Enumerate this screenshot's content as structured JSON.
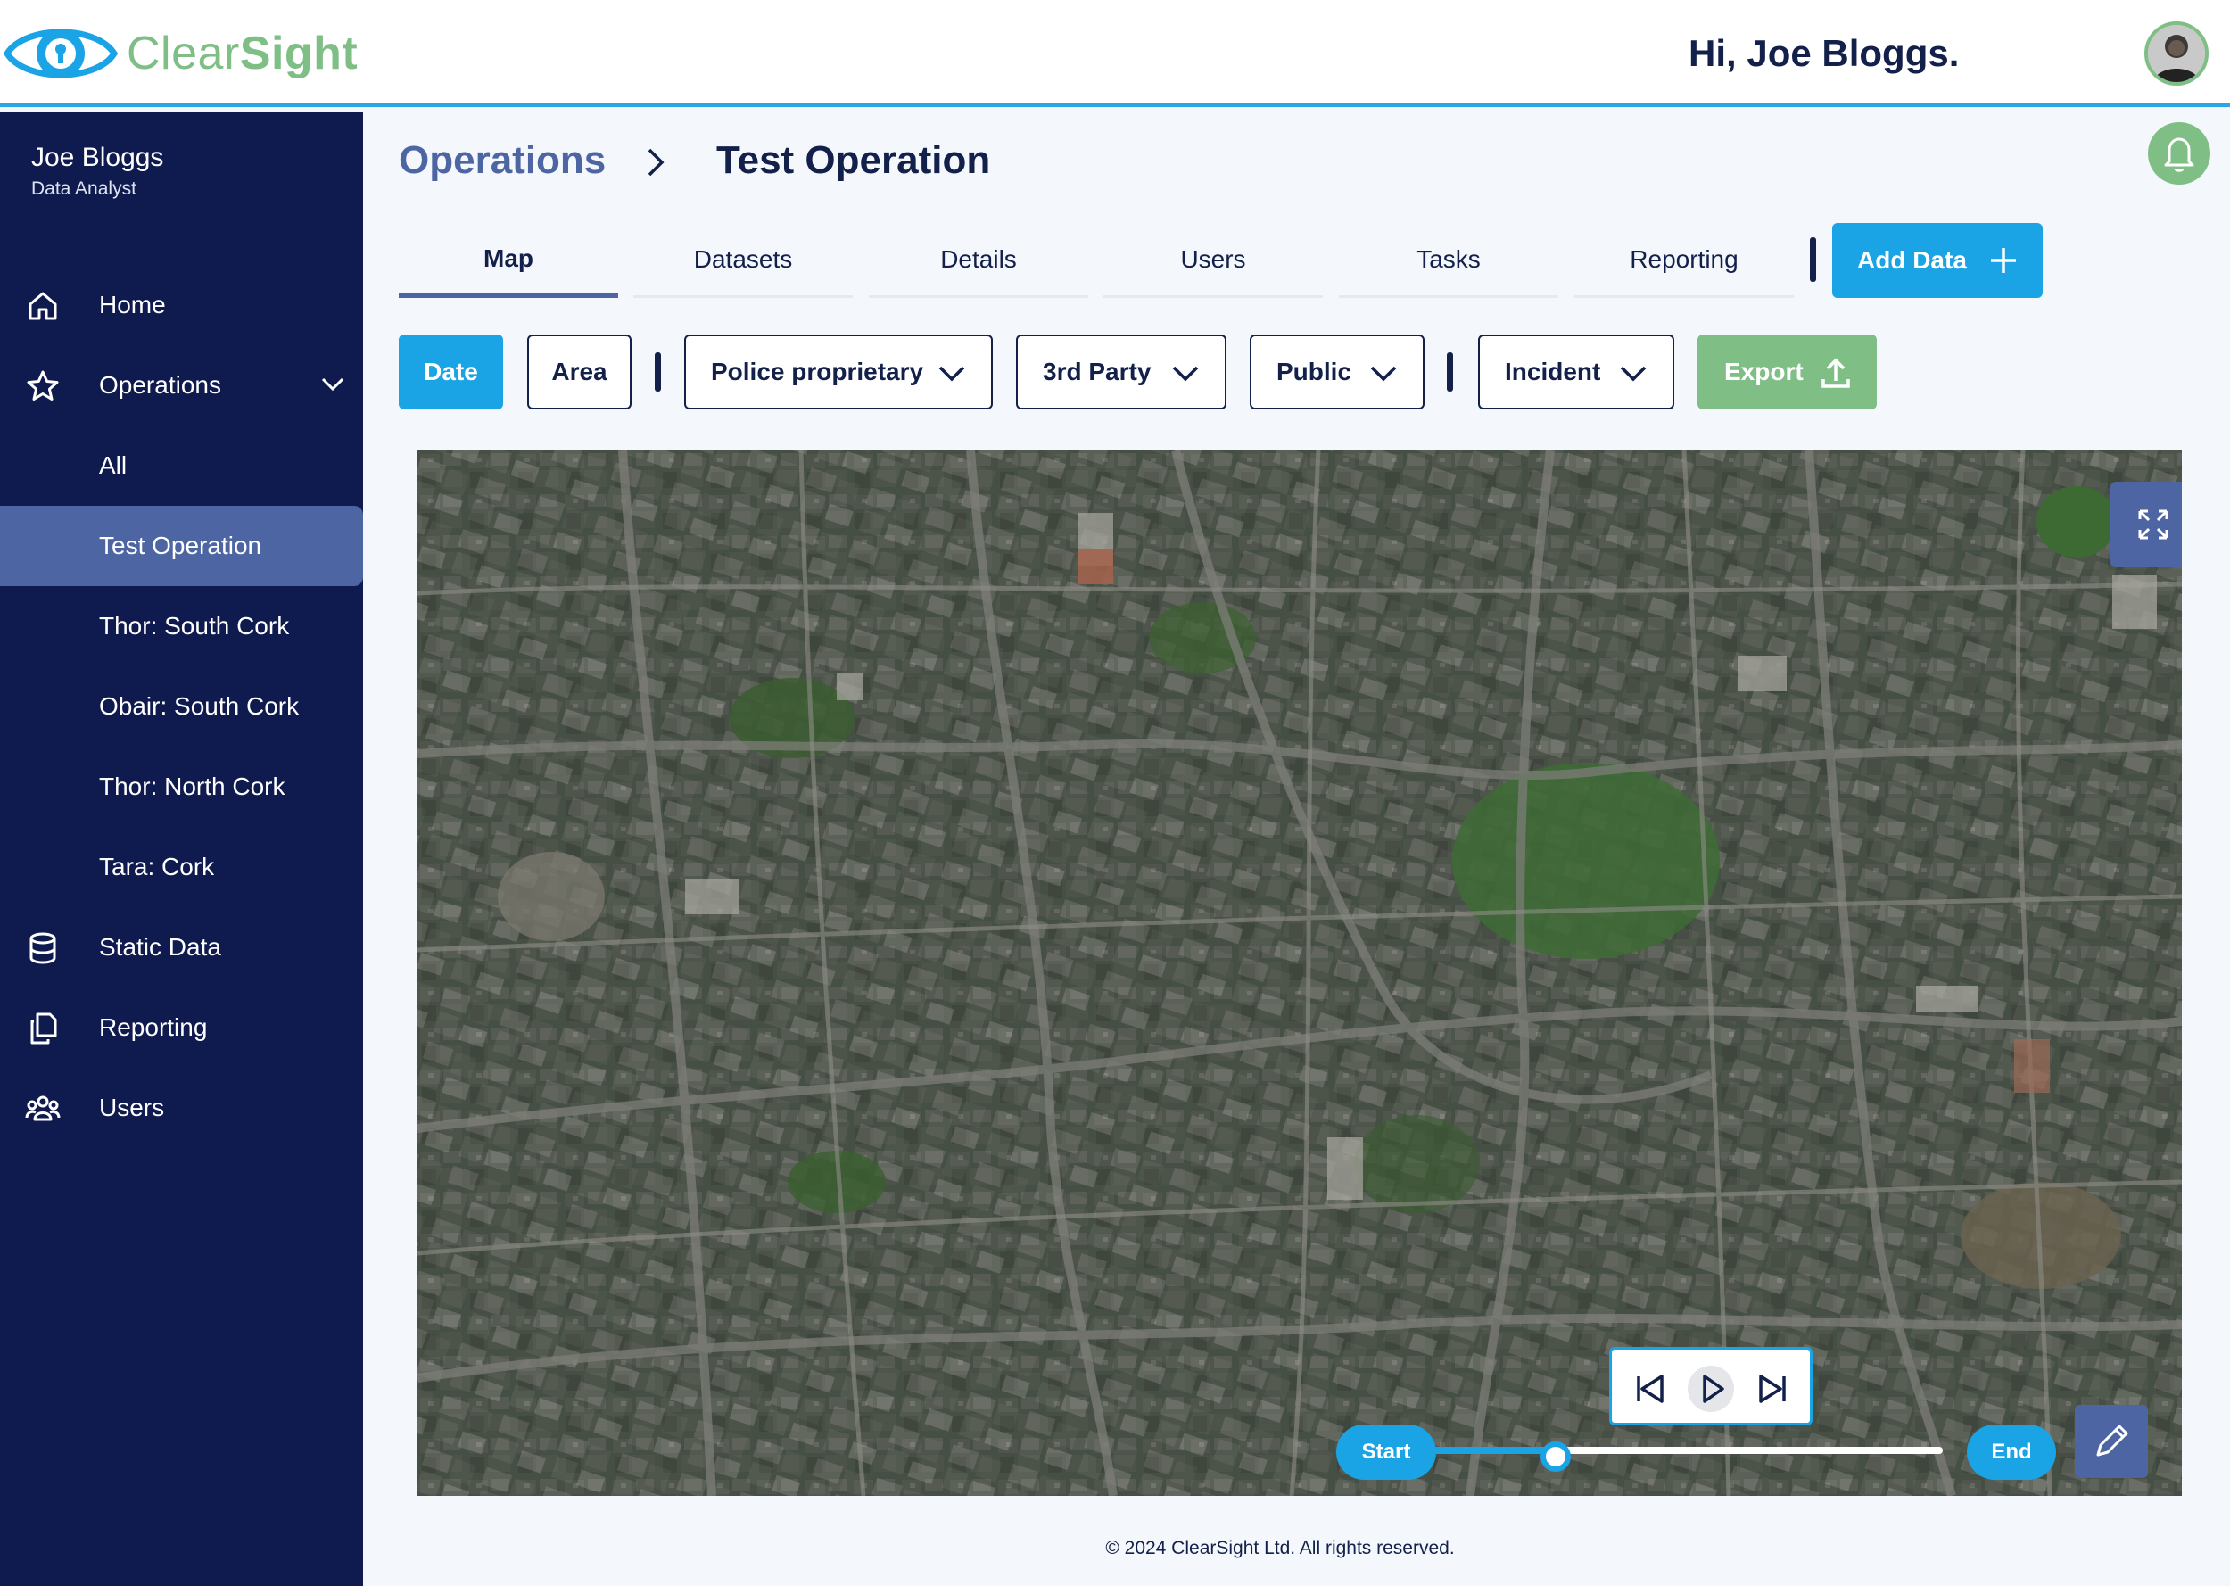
{
  "brand": {
    "name_part1": "Clear",
    "name_part2": "Sight"
  },
  "header": {
    "greeting": "Hi, Joe Bloggs."
  },
  "sidebar": {
    "user_name": "Joe Bloggs",
    "user_role": "Data Analyst",
    "items": [
      {
        "label": "Home",
        "icon": "home-icon"
      },
      {
        "label": "Operations",
        "icon": "star-icon",
        "expanded": true
      },
      {
        "label": "All"
      },
      {
        "label": "Test Operation",
        "active": true
      },
      {
        "label": "Thor: South Cork"
      },
      {
        "label": "Obair: South Cork"
      },
      {
        "label": "Thor: North Cork"
      },
      {
        "label": "Tara: Cork"
      },
      {
        "label": "Static Data",
        "icon": "database-icon"
      },
      {
        "label": "Reporting",
        "icon": "documents-icon"
      },
      {
        "label": "Users",
        "icon": "users-icon"
      }
    ]
  },
  "breadcrumb": {
    "parent": "Operations",
    "current": "Test Operation"
  },
  "tabs": [
    {
      "label": "Map",
      "active": true
    },
    {
      "label": "Datasets"
    },
    {
      "label": "Details"
    },
    {
      "label": "Users"
    },
    {
      "label": "Tasks"
    },
    {
      "label": "Reporting"
    }
  ],
  "actions": {
    "add_data": "Add Data",
    "export": "Export"
  },
  "filters": {
    "date": "Date",
    "area": "Area",
    "police": "Police proprietary",
    "third_party": "3rd Party",
    "public": "Public",
    "incident": "Incident"
  },
  "timeline": {
    "start": "Start",
    "end": "End",
    "progress": 0.3
  },
  "footer": {
    "copyright": "© 2024 ClearSight Ltd. All rights reserved."
  },
  "colors": {
    "navy": "#0f1a4f",
    "blue": "#1aa3e5",
    "green": "#7fbf86",
    "slate": "#4d66a3"
  }
}
